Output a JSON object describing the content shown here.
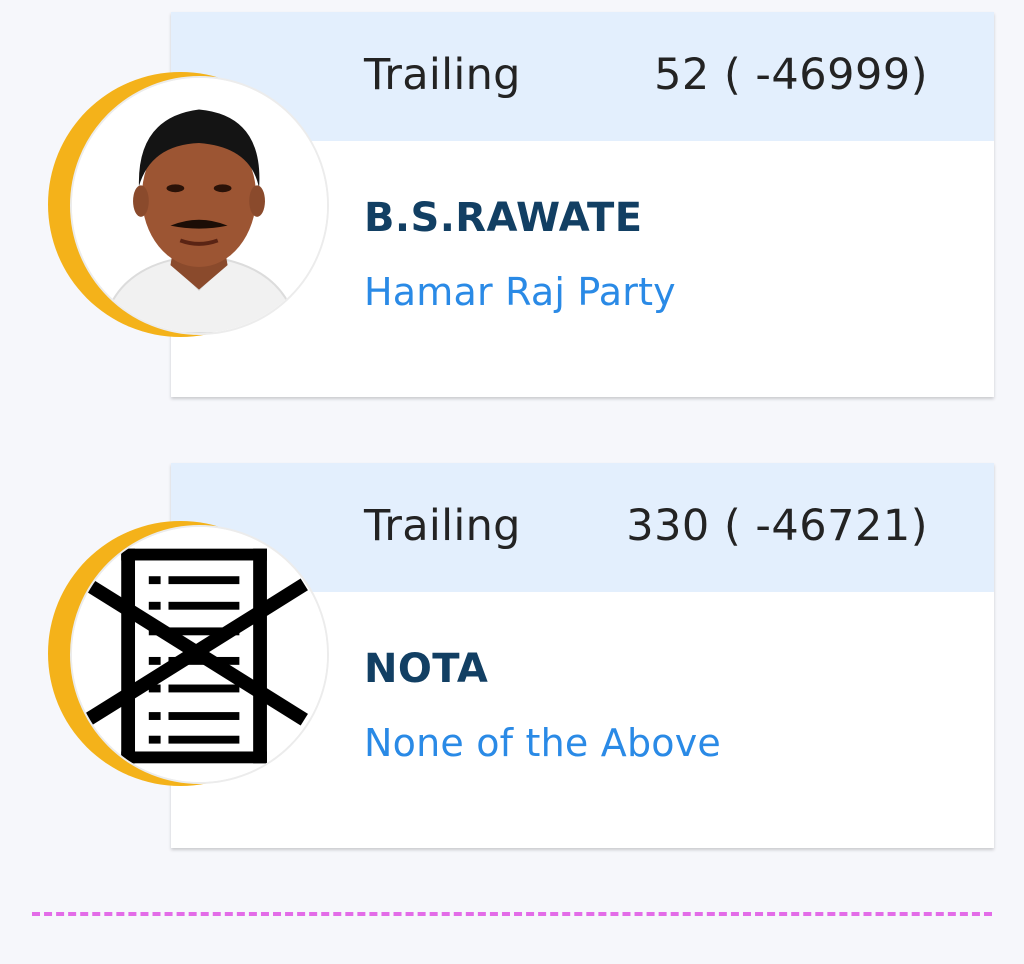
{
  "candidates": [
    {
      "status": "Trailing",
      "votes": "52 ( -46999)",
      "name": "B.S.RAWATE",
      "party": "Hamar Raj Party",
      "avatar_icon": "candidate-photo"
    },
    {
      "status": "Trailing",
      "votes": "330 ( -46721)",
      "name": "NOTA",
      "party": "None of the Above",
      "avatar_icon": "nota-ballot-crossed-icon"
    }
  ],
  "colors": {
    "header_bg": "#e3effd",
    "name_color": "#123f63",
    "party_color": "#2a8ae6",
    "ring_color": "#f4b21a",
    "divider_color": "#e36ce8"
  }
}
